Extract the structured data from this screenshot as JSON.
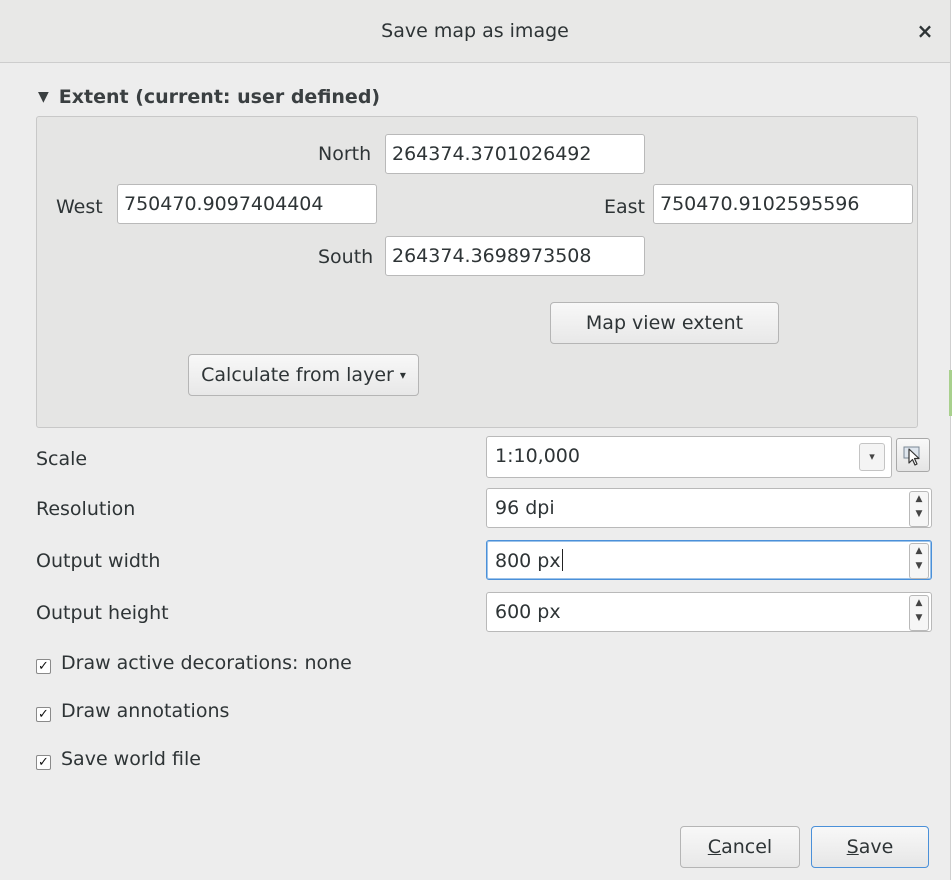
{
  "dialog": {
    "title": "Save map as image",
    "close_glyph": "×"
  },
  "extent": {
    "header": "Extent (current: user defined)",
    "north_label": "North",
    "north_value": "264374.3701026492",
    "west_label": "West",
    "west_value": "750470.9097404404",
    "east_label": "East",
    "east_value": "750470.9102595596",
    "south_label": "South",
    "south_value": "264374.3698973508",
    "map_view_button": "Map view extent",
    "calculate_button": "Calculate from layer"
  },
  "settings": {
    "scale_label": "Scale",
    "scale_value": "1:10,000",
    "resolution_label": "Resolution",
    "resolution_value": "96 dpi",
    "width_label": "Output width",
    "width_value": "800 px",
    "height_label": "Output height",
    "height_value": "600 px"
  },
  "options": [
    {
      "label": "Draw active decorations: none",
      "checked": true
    },
    {
      "label": "Draw annotations",
      "checked": true
    },
    {
      "label": "Save world file",
      "checked": true
    }
  ],
  "footer": {
    "cancel_mnemonic": "C",
    "cancel_rest": "ancel",
    "save_mnemonic": "S",
    "save_rest": "ave"
  },
  "icons": {
    "collapse": "triangle-down-icon",
    "map-canvas-picker": "cursor-icon",
    "dropdown": "chevron-down-icon"
  },
  "colors": {
    "focus": "#4a90d9",
    "dialog_bg": "#ededed"
  }
}
